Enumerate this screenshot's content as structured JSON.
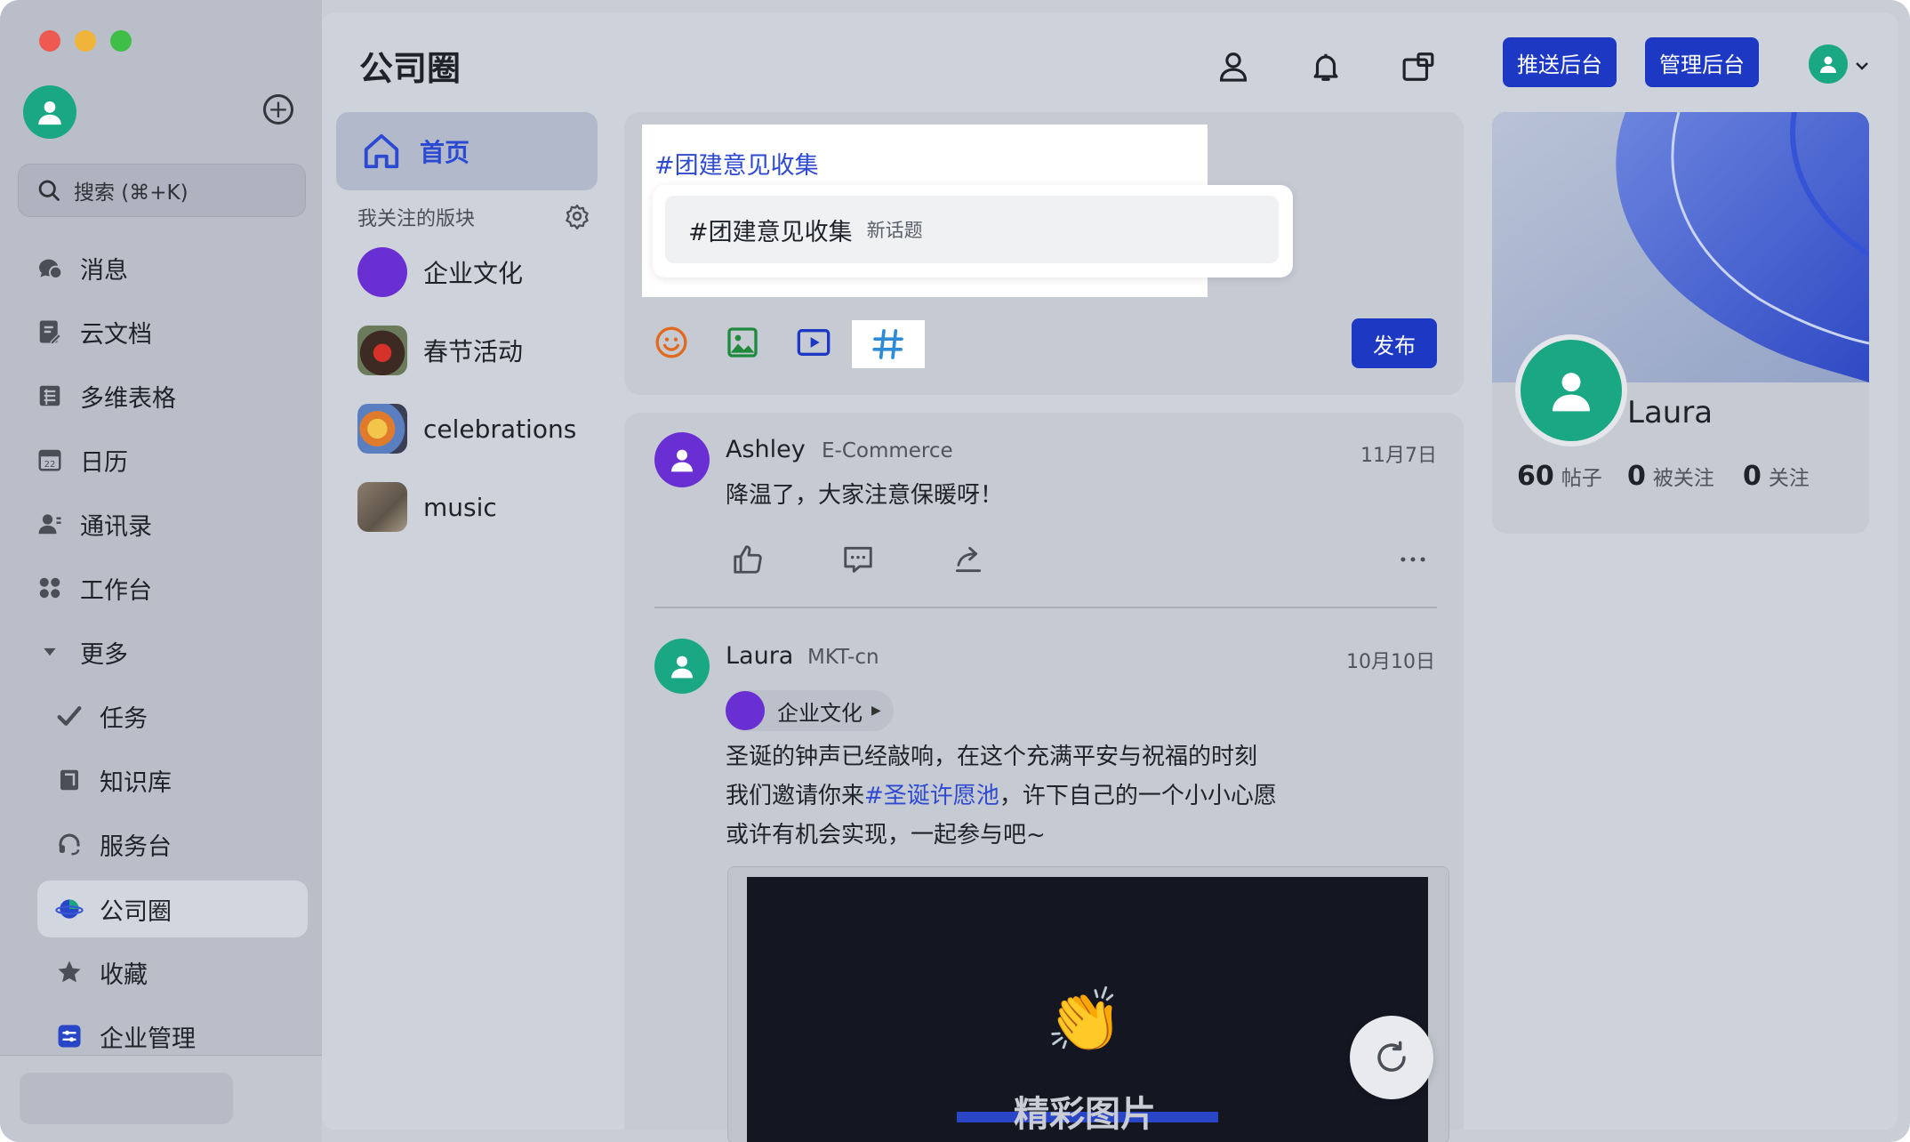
{
  "sidebar": {
    "search_label": "搜索 (⌘+K)",
    "items": [
      {
        "label": "消息",
        "icon": "message-icon"
      },
      {
        "label": "云文档",
        "icon": "doc-icon"
      },
      {
        "label": "多维表格",
        "icon": "table-icon"
      },
      {
        "label": "日历",
        "icon": "calendar-icon"
      },
      {
        "label": "通讯录",
        "icon": "contacts-icon"
      },
      {
        "label": "工作台",
        "icon": "workspace-icon"
      },
      {
        "label": "更多",
        "icon": "caret-down-icon"
      },
      {
        "label": "任务",
        "icon": "task-icon"
      },
      {
        "label": "知识库",
        "icon": "wiki-icon"
      },
      {
        "label": "服务台",
        "icon": "headset-icon"
      },
      {
        "label": "公司圈",
        "icon": "moments-icon"
      },
      {
        "label": "收藏",
        "icon": "star-icon"
      },
      {
        "label": "企业管理",
        "icon": "admin-icon"
      }
    ],
    "calendar_day": "22"
  },
  "header": {
    "title": "公司圈",
    "push_admin_label": "推送后台",
    "manage_admin_label": "管理后台"
  },
  "boards": {
    "home_label": "首页",
    "followed_header": "我关注的版块",
    "items": [
      {
        "name": "企业文化"
      },
      {
        "name": "春节活动"
      },
      {
        "name": "celebrations"
      },
      {
        "name": "music"
      }
    ]
  },
  "composer": {
    "input_text": "#团建意见收集",
    "suggestion_name": "#团建意见收集",
    "suggestion_tag": "新话题",
    "publish_label": "发布"
  },
  "posts": [
    {
      "author": "Ashley",
      "dept": "E-Commerce",
      "date": "11月7日",
      "text": "降温了，大家注意保暖呀！"
    },
    {
      "author": "Laura",
      "dept": "MKT-cn",
      "date": "10月10日",
      "board": "企业文化",
      "line1": "圣诞的钟声已经敲响，在这个充满平安与祝福的时刻",
      "line2_prefix": "我们邀请你来",
      "line2_link": "#圣诞许愿池",
      "line2_suffix": "，许下自己的一个小小心愿",
      "line3": "或许有机会实现，一起参与吧~",
      "media_caption": "精彩图片"
    }
  ],
  "profile": {
    "name": "Laura",
    "posts_count": "60",
    "posts_label": "帖子",
    "followers_count": "0",
    "followers_label": "被关注",
    "following_count": "0",
    "following_label": "关注"
  },
  "colors": {
    "accent": "#1d39c4",
    "link": "#2e4ad1",
    "avatar_green": "#1aa783",
    "avatar_purple": "#6a2fd3"
  }
}
